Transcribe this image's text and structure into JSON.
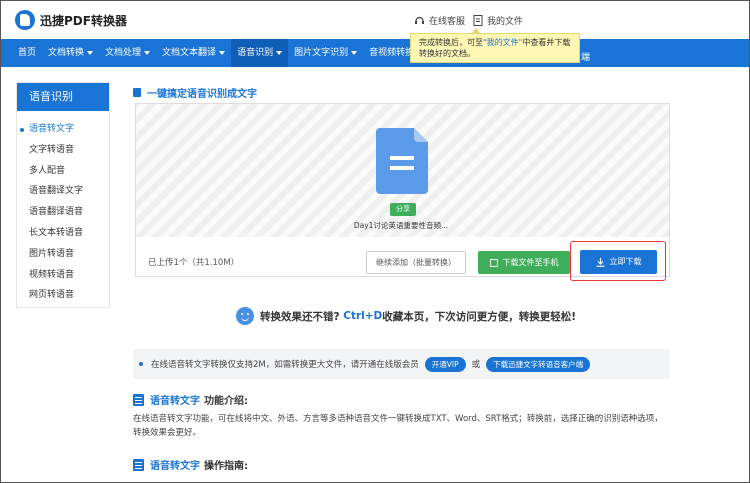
{
  "header": {
    "app_title": "迅捷PDF转换器",
    "online_service": "在线客服",
    "my_files": "我的文件"
  },
  "nav": {
    "items": [
      {
        "label": "首页",
        "has_caret": false
      },
      {
        "label": "文档转换",
        "has_caret": true
      },
      {
        "label": "文档处理",
        "has_caret": true
      },
      {
        "label": "文档文本翻译",
        "has_caret": true
      },
      {
        "label": "语音识别",
        "has_caret": true,
        "active": true
      },
      {
        "label": "图片文字识别",
        "has_caret": true
      },
      {
        "label": "音视频转换",
        "has_caret": true
      }
    ],
    "tail": "端"
  },
  "tooltip": {
    "pre": "完成转换后，可至",
    "link": "\"我的文件\"",
    "post": "中查看并下载",
    "line2": "转换好的文档。"
  },
  "sidebar": {
    "title": "语音识别",
    "items": [
      {
        "label": "语音转文字",
        "active": true
      },
      {
        "label": "文字转语音"
      },
      {
        "label": "多人配音"
      },
      {
        "label": "语音翻译文字"
      },
      {
        "label": "语音翻译语音"
      },
      {
        "label": "长文本转语音"
      },
      {
        "label": "图片转语音"
      },
      {
        "label": "视频转语音"
      },
      {
        "label": "网页转语音"
      }
    ]
  },
  "main": {
    "section_title": "一键搞定语音识别成文字",
    "upload": {
      "share_badge": "分享",
      "file_name": "Day1讨论英语重要性音频...",
      "upload_count": "已上传1个（共1.10M）",
      "continue_button": "继续添加（批量转换）",
      "download_to_phone": "下载文件至手机",
      "download_now": "立即下载"
    },
    "promo": {
      "text1": "转换效果还不错?",
      "key": "Ctrl+D",
      "text2": "收藏本页，下次访问更方便，转换更轻松!"
    },
    "notice": {
      "text": "在线语音转文字转换仅支持2M，如需转换更大文件，请开通在线版会员",
      "vip_button": "开通VIP",
      "or": "或",
      "client_button": "下载迅捷文字转语音客户端"
    },
    "intro": {
      "keyword": "语音转文字",
      "title": "功能介绍:",
      "paragraph": "在线语音转文字功能，可在线将中文、外语、方言等多语种语音文件一键转换成TXT、Word、SRT格式；转换前，选择正确的识别语种选项，转换效果会更好。"
    },
    "guide": {
      "keyword": "语音转文字",
      "title": "操作指南:"
    }
  },
  "colors": {
    "brand_blue": "#1a74d6",
    "green": "#3fae5a",
    "highlight_red": "#e33333",
    "tooltip_bg": "#fff8b5"
  }
}
